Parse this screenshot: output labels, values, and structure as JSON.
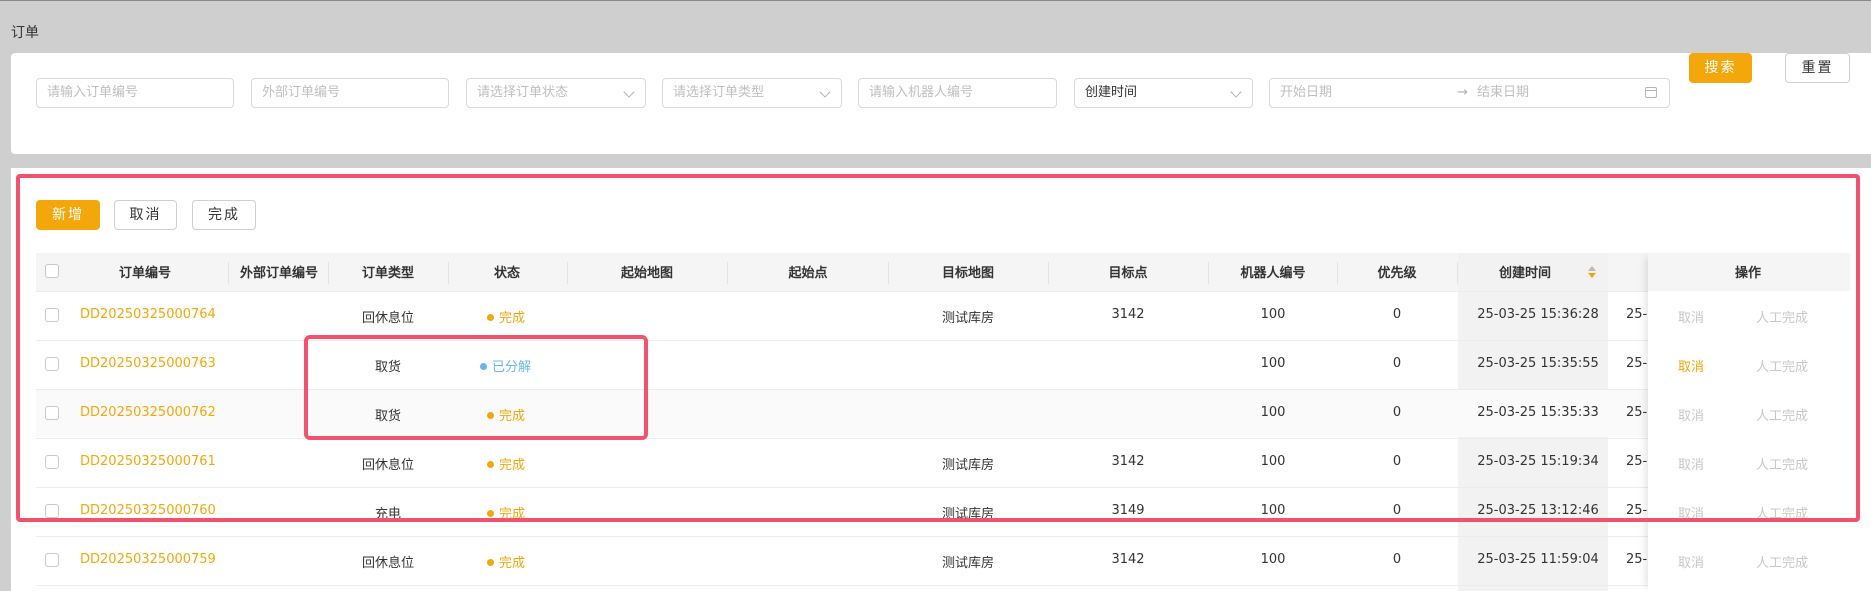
{
  "page": {
    "title": "订单"
  },
  "filters": {
    "order_no_placeholder": "请输入订单编号",
    "external_no_placeholder": "外部订单编号",
    "status_placeholder": "请选择订单状态",
    "type_placeholder": "请选择订单类型",
    "robot_placeholder": "请输入机器人编号",
    "time_type_value": "创建时间",
    "start_date_placeholder": "开始日期",
    "range_separator": "→",
    "end_date_placeholder": "结束日期",
    "search_label": "搜索",
    "reset_label": "重置"
  },
  "toolbar": {
    "add_label": "新增",
    "cancel_label": "取消",
    "complete_label": "完成"
  },
  "table": {
    "columns": [
      "订单编号",
      "外部订单编号",
      "订单类型",
      "状态",
      "起始地图",
      "起始点",
      "目标地图",
      "目标点",
      "机器人编号",
      "优先级",
      "创建时间",
      "",
      "操作"
    ],
    "rows": [
      {
        "order_no": "DD20250325000764",
        "external_no": "",
        "type": "回休息位",
        "status": "完成",
        "start_map": "",
        "start_point": "",
        "target_map": "测试库房",
        "target_point": "3142",
        "robot": "100",
        "priority": "0",
        "created": "25-03-25 15:36:28",
        "next": "25-",
        "op_cancel": "取消",
        "op_manual": "人工完成"
      },
      {
        "order_no": "DD20250325000763",
        "external_no": "",
        "type": "取货",
        "status": "已分解",
        "start_map": "",
        "start_point": "",
        "target_map": "",
        "target_point": "",
        "robot": "100",
        "priority": "0",
        "created": "25-03-25 15:35:55",
        "next": "25-",
        "op_cancel": "取消",
        "op_manual": "人工完成"
      },
      {
        "order_no": "DD20250325000762",
        "external_no": "",
        "type": "取货",
        "status": "完成",
        "start_map": "",
        "start_point": "",
        "target_map": "",
        "target_point": "",
        "robot": "100",
        "priority": "0",
        "created": "25-03-25 15:35:33",
        "next": "25-",
        "op_cancel": "取消",
        "op_manual": "人工完成"
      },
      {
        "order_no": "DD20250325000761",
        "external_no": "",
        "type": "回休息位",
        "status": "完成",
        "start_map": "",
        "start_point": "",
        "target_map": "测试库房",
        "target_point": "3142",
        "robot": "100",
        "priority": "0",
        "created": "25-03-25 15:19:34",
        "next": "25-",
        "op_cancel": "取消",
        "op_manual": "人工完成"
      },
      {
        "order_no": "DD20250325000760",
        "external_no": "",
        "type": "充电",
        "status": "完成",
        "start_map": "",
        "start_point": "",
        "target_map": "测试库房",
        "target_point": "3149",
        "robot": "100",
        "priority": "0",
        "created": "25-03-25 13:12:46",
        "next": "25-",
        "op_cancel": "取消",
        "op_manual": "人工完成"
      },
      {
        "order_no": "DD20250325000759",
        "external_no": "",
        "type": "回休息位",
        "status": "完成",
        "start_map": "",
        "start_point": "",
        "target_map": "测试库房",
        "target_point": "3142",
        "robot": "100",
        "priority": "0",
        "created": "25-03-25 11:59:04",
        "next": "25-",
        "op_cancel": "取消",
        "op_manual": "人工完成"
      }
    ]
  },
  "colors": {
    "accent": "#f4a70a",
    "split_status": "#68b7f0",
    "highlight": "#f3526e"
  }
}
